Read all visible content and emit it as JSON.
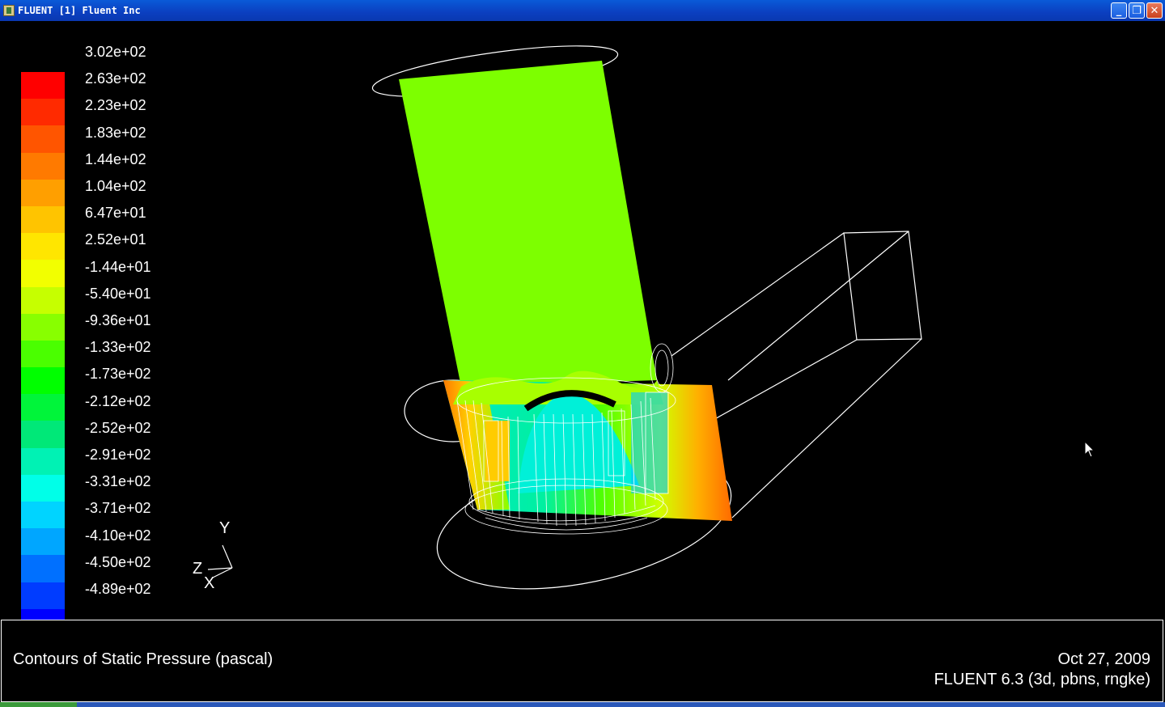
{
  "window": {
    "title": "FLUENT  [1] Fluent Inc",
    "buttons": {
      "minimize": "_",
      "maximize": "❐",
      "close": "✕"
    }
  },
  "legend": {
    "labels": [
      "3.02e+02",
      "2.63e+02",
      "2.23e+02",
      "1.83e+02",
      "1.44e+02",
      "1.04e+02",
      "6.47e+01",
      "2.52e+01",
      "-1.44e+01",
      "-5.40e+01",
      "-9.36e+01",
      "-1.33e+02",
      "-1.73e+02",
      "-2.12e+02",
      "-2.52e+02",
      "-2.91e+02",
      "-3.31e+02",
      "-3.71e+02",
      "-4.10e+02",
      "-4.50e+02",
      "-4.89e+02"
    ],
    "colors": [
      "#ff0000",
      "#ff2a00",
      "#ff5500",
      "#ff7a00",
      "#ff9f00",
      "#ffc400",
      "#ffe600",
      "#f2ff00",
      "#c6ff00",
      "#88ff00",
      "#4aff00",
      "#00ff00",
      "#00f53a",
      "#00e878",
      "#00f2b4",
      "#00ffe8",
      "#00d4ff",
      "#00a6ff",
      "#0070ff",
      "#003cff",
      "#0000ff"
    ]
  },
  "axes": {
    "y": "Y",
    "z": "Z",
    "x": "X"
  },
  "info": {
    "plot_title": "Contours of Static Pressure (pascal)",
    "date": "Oct 27, 2009",
    "version": "FLUENT 6.3 (3d, pbns, rngke)"
  }
}
